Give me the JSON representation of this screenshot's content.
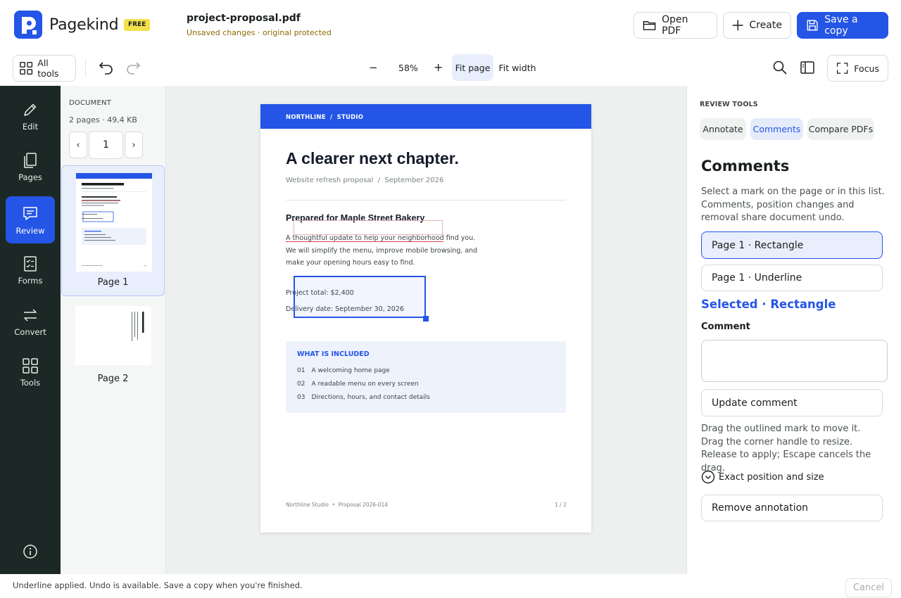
{
  "app": {
    "brand": "Pagekind",
    "plan_badge": "FREE"
  },
  "file": {
    "name": "project-proposal.pdf",
    "status": "Unsaved changes · original protected"
  },
  "header_actions": {
    "open_pdf": "Open PDF",
    "create": "Create",
    "save_copy": "Save a copy"
  },
  "toolbar": {
    "all_tools": "All tools",
    "zoom_out": "−",
    "zoom_value": "58%",
    "zoom_in": "+",
    "fit_page": "Fit page",
    "fit_width": "Fit width",
    "focus": "Focus"
  },
  "rail": {
    "items": [
      {
        "label": "Edit",
        "icon": "pencil-icon"
      },
      {
        "label": "Pages",
        "icon": "pages-icon"
      },
      {
        "label": "Review",
        "icon": "comment-icon"
      },
      {
        "label": "Forms",
        "icon": "form-icon"
      },
      {
        "label": "Convert",
        "icon": "convert-icon"
      },
      {
        "label": "Tools",
        "icon": "grid-icon"
      }
    ],
    "active": "Review"
  },
  "thumbnails": {
    "heading": "DOCUMENT",
    "meta": "2 pages · 49,4 KB",
    "prev": "‹",
    "current_page": "1",
    "next": "›",
    "pages": [
      {
        "label": "Page 1"
      },
      {
        "label": "Page 2"
      }
    ]
  },
  "document": {
    "band": "NORTHLINE  /  STUDIO",
    "title": "A clearer next chapter.",
    "subtitle": "Website refresh proposal  /  September 2026",
    "prepared": "Prepared for Maple Street Bakery",
    "body": [
      "A thoughtful update to help your neighborhood find you.",
      "We will simplify the menu, improve mobile browsing, and",
      "make your opening hours easy to find."
    ],
    "total": "Project total: $2,400",
    "delivery": "Delivery date: September 30, 2026",
    "included_heading": "WHAT IS INCLUDED",
    "included": [
      {
        "num": "01",
        "text": "A welcoming home page"
      },
      {
        "num": "02",
        "text": "A readable menu on every screen"
      },
      {
        "num": "03",
        "text": "Directions, hours, and contact details"
      }
    ],
    "footer_left": "Northline Studio  •  Proposal 2026-014",
    "footer_right": "1 / 2"
  },
  "review": {
    "section_label": "REVIEW TOOLS",
    "tabs": [
      "Annotate",
      "Comments",
      "Compare PDFs"
    ],
    "active_tab": "Comments",
    "title": "Comments",
    "description": "Select a mark on the page or in this list. Comments, position changes and removal share document undo.",
    "annotations": [
      "Page 1 · Rectangle",
      "Page 1 · Underline"
    ],
    "selected_heading": "Selected · Rectangle",
    "comment_label": "Comment",
    "comment_value": "",
    "update_button": "Update comment",
    "drag_hint": "Drag the outlined mark to move it. Drag the corner handle to resize. Release to apply; Escape cancels the drag.",
    "exact_toggle": "Exact position and size",
    "remove_button": "Remove annotation"
  },
  "status": {
    "message": "Underline applied. Undo is available. Save a copy when you're finished.",
    "cancel": "Cancel"
  },
  "colors": {
    "accent": "#2455e6",
    "rail": "#1c2825",
    "badge": "#f3e04a",
    "underline_mark": "#d6434f"
  }
}
